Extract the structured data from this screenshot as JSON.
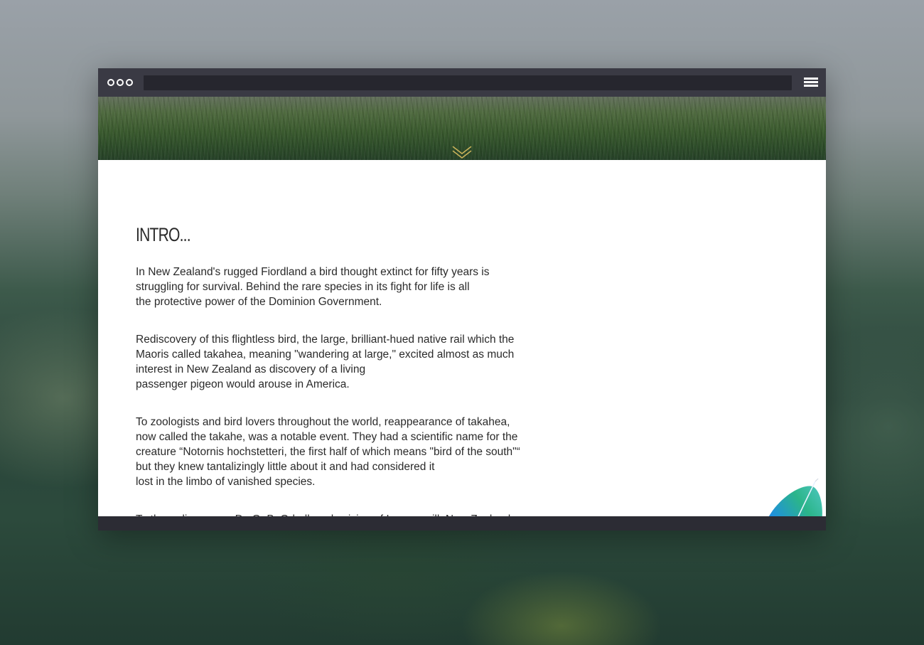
{
  "window": {
    "titlebar": {
      "controls": [
        "circle-icon",
        "circle-icon",
        "circle-icon"
      ],
      "address_value": "",
      "menu_icon": "hamburger-menu-icon"
    },
    "hero": {
      "scroll_icon": "double-chevron-down-icon",
      "accent_color": "#c8b25a"
    }
  },
  "article": {
    "title": "INTRO...",
    "paragraphs": [
      "In New Zealand's rugged Fiordland a bird thought extinct for fifty years is\nstruggling for survival. Behind the rare species in its fight for life is all\nthe protective power of the Dominion Government.",
      "Rediscovery of this flightless bird, the large, brilliant-hued native rail which the\nMaoris called takahea, meaning \"wandering at large,\" excited almost as much\ninterest in New Zealand as discovery of a living\npassenger pigeon would arouse in America.",
      "To zoologists and bird lovers throughout the world, reappearance of takahea,\nnow called the takahe, was a notable event. They had a scientific name for the\ncreature “Notornis hochstetteri, the first half of which means \"bird of the south\"“\nbut they knew tantalizingly little about it and had considered it\nlost in the limbo of vanished species.",
      "To the rediscoverer, Dr. G. B. Orbell, a physician of Invercargill, New Zealand,"
    ],
    "illustration": "blue-feather-icon"
  }
}
